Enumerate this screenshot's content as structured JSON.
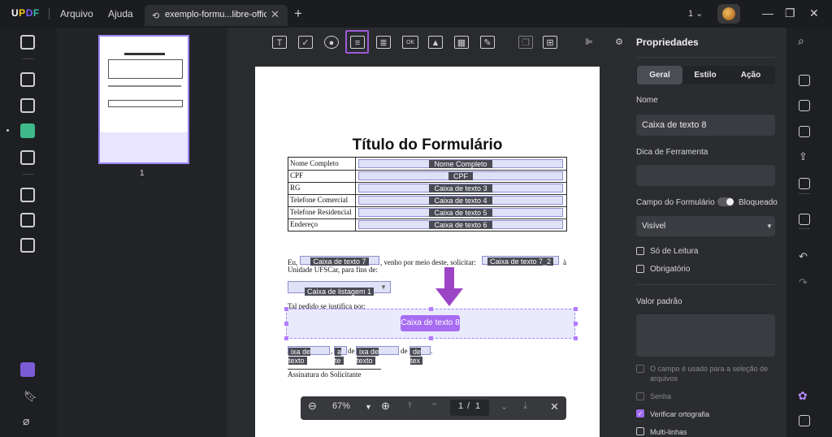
{
  "app": {
    "logo": "UPDF"
  },
  "menu": {
    "file": "Arquivo",
    "help": "Ajuda"
  },
  "tab": {
    "title": "exemplo-formu...libre-office*"
  },
  "window": {
    "zoom_dropdown": "1",
    "minimize": "—",
    "restore": "❐",
    "close": "✕"
  },
  "thumbnail": {
    "page_number": "1"
  },
  "document": {
    "title": "Título do Formulário",
    "rows": [
      {
        "label": "Nome Completo",
        "field": "Nome Completo"
      },
      {
        "label": "CPF",
        "field": "CPF"
      },
      {
        "label": "RG",
        "field": "Caixa de texto 3"
      },
      {
        "label": "Telefone Comercial",
        "field": "Caixa de texto 4"
      },
      {
        "label": "Telefone Residencial",
        "field": "Caixa de texto 5"
      },
      {
        "label": "Endereço",
        "field": "Caixa de texto 6"
      }
    ],
    "para_eu": "Eu,",
    "field_7": "Caixa de texto 7",
    "para_mid": ", venho por meio deste, solicitar:",
    "field_7_2": "Caixa de texto 7_2",
    "para_a": "à",
    "para_unidade": "Unidade UFSCar, para fins de:",
    "listbox": "Caixa de listagem 1",
    "para_justifica": "Tal pedido se justifica por:",
    "selected_field": "Caixa de texto 8",
    "date_field_a": "ixa de texto",
    "date_sep_a": ",",
    "date_field_b": "a te",
    "date_de_1": "de",
    "date_field_c": "ixa de texto",
    "date_de_2": "de",
    "date_field_d": "de tex",
    "date_end": ".",
    "signature": "Assinatura do Solicitante"
  },
  "bottom_toolbar": {
    "zoom": "67%",
    "page_current": "1",
    "page_sep": "/",
    "page_total": "1"
  },
  "properties": {
    "title": "Propriedades",
    "tabs": [
      "Geral",
      "Estilo",
      "Ação"
    ],
    "name_label": "Nome",
    "name_value": "Caixa de texto 8",
    "tooltip_label": "Dica de Ferramenta",
    "tooltip_value": "",
    "field_label": "Campo do Formulário",
    "locked_label": "Bloqueado",
    "visibility": "Visível",
    "readonly_label": "Só de Leitura",
    "required_label": "Obrigatório",
    "default_label": "Valor padrão",
    "file_select_label": "O campo é usado para a seleção de arquivos",
    "password_label": "Senha",
    "spellcheck_label": "Verificar ortografia",
    "multiline_label": "Multi-linhas"
  },
  "colors": {
    "accent": "#9d6cf0",
    "selection": "#a66cf2",
    "field_fill": "#dfe1f7"
  }
}
